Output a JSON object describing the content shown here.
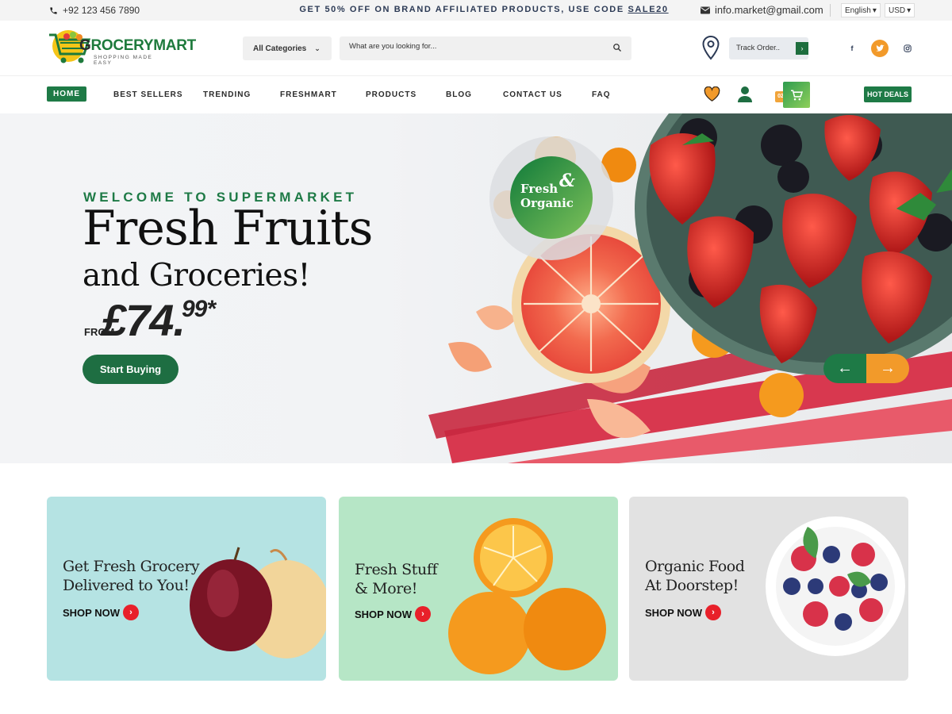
{
  "topbar": {
    "phone": "+92 123 456 7890",
    "promo_text": "GET 50% OFF ON BRAND AFFILIATED PRODUCTS, USE CODE ",
    "promo_code": "SALE20",
    "email": "info.market@gmail.com",
    "language": "English",
    "currency": "USD"
  },
  "header": {
    "logo_brand_g": "G",
    "logo_brand_rest": "ROCERYMART",
    "logo_tagline": "SHOPPING MADE EASY",
    "category_select": "All Categories",
    "search_placeholder": "What are you looking for...",
    "track_placeholder": "Track Order..",
    "social": [
      "facebook-icon",
      "twitter-icon",
      "instagram-icon"
    ]
  },
  "nav": {
    "items": [
      "HOME",
      "BEST SELLERS",
      "TRENDING",
      "FRESHMART",
      "PRODUCTS",
      "BLOG",
      "CONTACT US",
      "FAQ"
    ],
    "cart_count": "02",
    "hot_deals": "HOT DEALS"
  },
  "hero": {
    "welcome": "WELCOME TO SUPERMARKET",
    "headline_1": "Fresh Fruits",
    "headline_2": "and Groceries!",
    "from_label": "FROM",
    "price_main": "£74.",
    "price_cents": "99*",
    "cta": "Start Buying",
    "badge_line1": "Fresh",
    "badge_amp": "&",
    "badge_line2": "Organic"
  },
  "cards": [
    {
      "title": "Get Fresh Grocery\nDelivered  to You!",
      "cta": "SHOP NOW",
      "bg": "#b5e3e3"
    },
    {
      "title": "Fresh Stuff\n& More!",
      "cta": "SHOP NOW",
      "bg": "#b6e6c6"
    },
    {
      "title": "Organic Food\nAt Doorstep!",
      "cta": "SHOP NOW",
      "bg": "#e2e2e2"
    }
  ],
  "colors": {
    "brand_green": "#1e7a46",
    "accent_orange": "#f29a2a",
    "accent_red": "#e8202a"
  }
}
